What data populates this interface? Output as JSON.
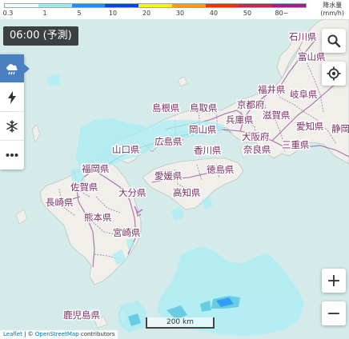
{
  "legend": {
    "ticks": [
      "0.3",
      "1",
      "5",
      "10",
      "20",
      "30",
      "40",
      "50",
      "80~"
    ],
    "unit_line1": "降水量",
    "unit_line2": "(mm/h)",
    "colors": [
      "#f2fdfe",
      "#a0d2ff",
      "#218cff",
      "#0041ff",
      "#faf500",
      "#ff9900",
      "#ff2800",
      "#d0234b",
      "#b40068"
    ]
  },
  "time": "06:00 (予測)",
  "layers": [
    {
      "name": "rain",
      "icon": "cloud-rain-icon",
      "active": true
    },
    {
      "name": "lightning",
      "icon": "lightning-icon",
      "active": false
    },
    {
      "name": "snow",
      "icon": "snowflake-icon",
      "active": false
    },
    {
      "name": "more",
      "icon": "more-icon",
      "active": false
    }
  ],
  "controls": {
    "zoom_in": "+",
    "zoom_out": "−"
  },
  "scale_label": "200 km",
  "attribution": {
    "leaflet": "Leaflet",
    "sep": " | © ",
    "osm": "OpenStreetMap",
    "contrib": " contributors"
  },
  "prefectures": [
    {
      "id": "ishikawa",
      "name": "石川県"
    },
    {
      "id": "toyama",
      "name": "富山県"
    },
    {
      "id": "fukui",
      "name": "福井県"
    },
    {
      "id": "gifu",
      "name": "岐阜県"
    },
    {
      "id": "shimane",
      "name": "島根県"
    },
    {
      "id": "tottori",
      "name": "鳥取県"
    },
    {
      "id": "kyoto",
      "name": "京都府"
    },
    {
      "id": "shiga",
      "name": "滋賀県"
    },
    {
      "id": "okayama",
      "name": "岡山県"
    },
    {
      "id": "hyogo",
      "name": "兵庫県"
    },
    {
      "id": "aichi",
      "name": "愛知県"
    },
    {
      "id": "shizuoka",
      "name": "静岡"
    },
    {
      "id": "yamaguchi",
      "name": "山口県"
    },
    {
      "id": "hiroshima",
      "name": "広島県"
    },
    {
      "id": "kagawa",
      "name": "香川県"
    },
    {
      "id": "osaka",
      "name": "大阪府"
    },
    {
      "id": "nara",
      "name": "奈良県"
    },
    {
      "id": "mie",
      "name": "三重県"
    },
    {
      "id": "fukuoka",
      "name": "福岡県"
    },
    {
      "id": "ehime",
      "name": "愛媛県"
    },
    {
      "id": "tokushima",
      "name": "徳島県"
    },
    {
      "id": "saga",
      "name": "佐賀県"
    },
    {
      "id": "oita",
      "name": "大分県"
    },
    {
      "id": "kochi",
      "name": "高知県"
    },
    {
      "id": "nagasaki",
      "name": "長崎県"
    },
    {
      "id": "kumamoto",
      "name": "熊本県"
    },
    {
      "id": "miyazaki",
      "name": "宮崎県"
    },
    {
      "id": "kagoshima",
      "name": "鹿児島県"
    }
  ]
}
